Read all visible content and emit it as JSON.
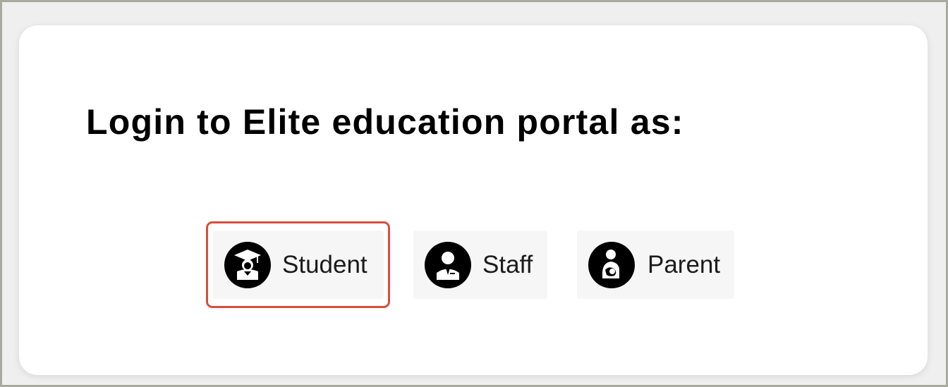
{
  "portal": {
    "title": "Login to Elite education portal as:"
  },
  "roles": [
    {
      "label": "Student",
      "icon": "graduate-icon",
      "selected": true
    },
    {
      "label": "Staff",
      "icon": "staff-person-icon",
      "selected": false
    },
    {
      "label": "Parent",
      "icon": "parent-child-icon",
      "selected": false
    }
  ],
  "colors": {
    "selection_border": "#d64f3c",
    "button_background": "#f6f6f6",
    "icon_background": "#000000",
    "frame_border": "#a8aaa0"
  }
}
